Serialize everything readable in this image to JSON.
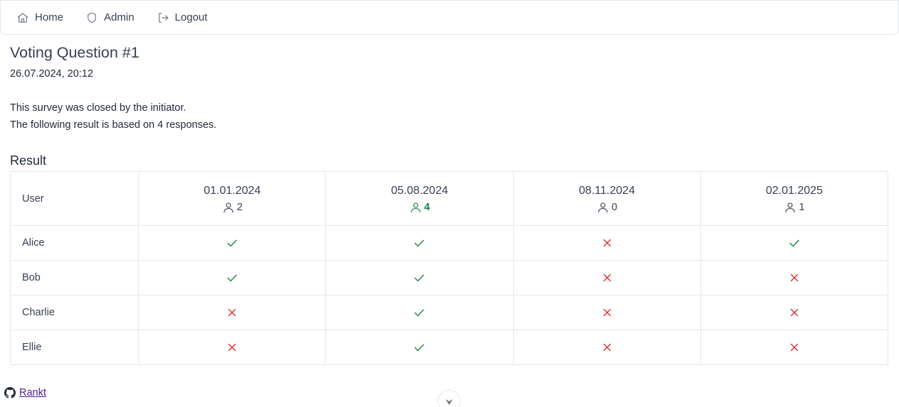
{
  "nav": {
    "home_label": "Home",
    "admin_label": "Admin",
    "logout_label": "Logout"
  },
  "survey": {
    "title": "Voting Question #1",
    "datetime": "26.07.2024, 20:12",
    "closed_text": "This survey was closed by the initiator.",
    "responses_text": "The following result is based on 4 responses."
  },
  "result": {
    "heading": "Result",
    "user_header": "User",
    "dates": [
      {
        "date": "01.01.2024",
        "count": "2",
        "winner": false
      },
      {
        "date": "05.08.2024",
        "count": "4",
        "winner": true
      },
      {
        "date": "08.11.2024",
        "count": "0",
        "winner": false
      },
      {
        "date": "02.01.2025",
        "count": "1",
        "winner": false
      }
    ],
    "rows": [
      {
        "user": "Alice",
        "votes": [
          "yes",
          "yes",
          "no",
          "yes"
        ]
      },
      {
        "user": "Bob",
        "votes": [
          "yes",
          "yes",
          "no",
          "no"
        ]
      },
      {
        "user": "Charlie",
        "votes": [
          "no",
          "yes",
          "no",
          "no"
        ]
      },
      {
        "user": "Ellie",
        "votes": [
          "no",
          "yes",
          "no",
          "no"
        ]
      }
    ]
  },
  "colors": {
    "yes": "#15803d",
    "no": "#dc2626",
    "winner": "#15803d"
  },
  "icons": {
    "home": "home-icon",
    "admin": "shield-icon",
    "logout": "logout-icon",
    "user_count": "user-icon",
    "yes": "check-icon",
    "no": "cross-icon",
    "github": "github-icon",
    "scroll": "chevron-down-icon"
  },
  "footer": {
    "link_label": "Rankt"
  }
}
